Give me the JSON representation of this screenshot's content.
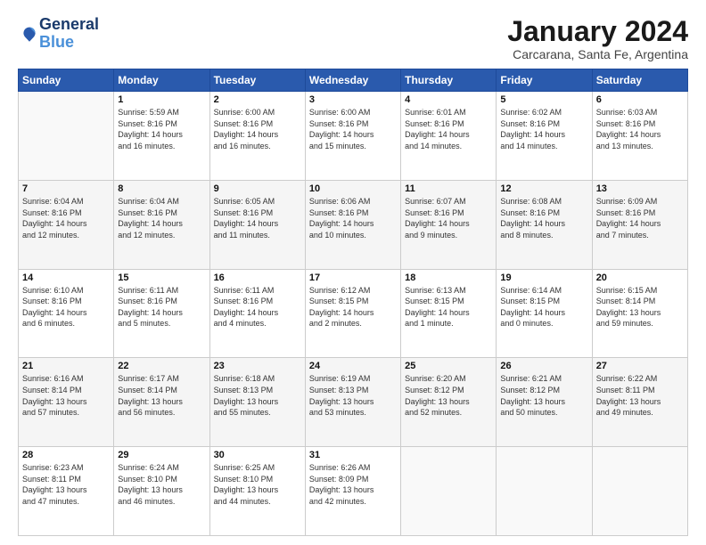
{
  "logo": {
    "line1": "General",
    "line2": "Blue"
  },
  "title": "January 2024",
  "subtitle": "Carcarana, Santa Fe, Argentina",
  "weekdays": [
    "Sunday",
    "Monday",
    "Tuesday",
    "Wednesday",
    "Thursday",
    "Friday",
    "Saturday"
  ],
  "weeks": [
    [
      {
        "day": "",
        "info": ""
      },
      {
        "day": "1",
        "info": "Sunrise: 5:59 AM\nSunset: 8:16 PM\nDaylight: 14 hours\nand 16 minutes."
      },
      {
        "day": "2",
        "info": "Sunrise: 6:00 AM\nSunset: 8:16 PM\nDaylight: 14 hours\nand 16 minutes."
      },
      {
        "day": "3",
        "info": "Sunrise: 6:00 AM\nSunset: 8:16 PM\nDaylight: 14 hours\nand 15 minutes."
      },
      {
        "day": "4",
        "info": "Sunrise: 6:01 AM\nSunset: 8:16 PM\nDaylight: 14 hours\nand 14 minutes."
      },
      {
        "day": "5",
        "info": "Sunrise: 6:02 AM\nSunset: 8:16 PM\nDaylight: 14 hours\nand 14 minutes."
      },
      {
        "day": "6",
        "info": "Sunrise: 6:03 AM\nSunset: 8:16 PM\nDaylight: 14 hours\nand 13 minutes."
      }
    ],
    [
      {
        "day": "7",
        "info": "Sunrise: 6:04 AM\nSunset: 8:16 PM\nDaylight: 14 hours\nand 12 minutes."
      },
      {
        "day": "8",
        "info": "Sunrise: 6:04 AM\nSunset: 8:16 PM\nDaylight: 14 hours\nand 12 minutes."
      },
      {
        "day": "9",
        "info": "Sunrise: 6:05 AM\nSunset: 8:16 PM\nDaylight: 14 hours\nand 11 minutes."
      },
      {
        "day": "10",
        "info": "Sunrise: 6:06 AM\nSunset: 8:16 PM\nDaylight: 14 hours\nand 10 minutes."
      },
      {
        "day": "11",
        "info": "Sunrise: 6:07 AM\nSunset: 8:16 PM\nDaylight: 14 hours\nand 9 minutes."
      },
      {
        "day": "12",
        "info": "Sunrise: 6:08 AM\nSunset: 8:16 PM\nDaylight: 14 hours\nand 8 minutes."
      },
      {
        "day": "13",
        "info": "Sunrise: 6:09 AM\nSunset: 8:16 PM\nDaylight: 14 hours\nand 7 minutes."
      }
    ],
    [
      {
        "day": "14",
        "info": "Sunrise: 6:10 AM\nSunset: 8:16 PM\nDaylight: 14 hours\nand 6 minutes."
      },
      {
        "day": "15",
        "info": "Sunrise: 6:11 AM\nSunset: 8:16 PM\nDaylight: 14 hours\nand 5 minutes."
      },
      {
        "day": "16",
        "info": "Sunrise: 6:11 AM\nSunset: 8:16 PM\nDaylight: 14 hours\nand 4 minutes."
      },
      {
        "day": "17",
        "info": "Sunrise: 6:12 AM\nSunset: 8:15 PM\nDaylight: 14 hours\nand 2 minutes."
      },
      {
        "day": "18",
        "info": "Sunrise: 6:13 AM\nSunset: 8:15 PM\nDaylight: 14 hours\nand 1 minute."
      },
      {
        "day": "19",
        "info": "Sunrise: 6:14 AM\nSunset: 8:15 PM\nDaylight: 14 hours\nand 0 minutes."
      },
      {
        "day": "20",
        "info": "Sunrise: 6:15 AM\nSunset: 8:14 PM\nDaylight: 13 hours\nand 59 minutes."
      }
    ],
    [
      {
        "day": "21",
        "info": "Sunrise: 6:16 AM\nSunset: 8:14 PM\nDaylight: 13 hours\nand 57 minutes."
      },
      {
        "day": "22",
        "info": "Sunrise: 6:17 AM\nSunset: 8:14 PM\nDaylight: 13 hours\nand 56 minutes."
      },
      {
        "day": "23",
        "info": "Sunrise: 6:18 AM\nSunset: 8:13 PM\nDaylight: 13 hours\nand 55 minutes."
      },
      {
        "day": "24",
        "info": "Sunrise: 6:19 AM\nSunset: 8:13 PM\nDaylight: 13 hours\nand 53 minutes."
      },
      {
        "day": "25",
        "info": "Sunrise: 6:20 AM\nSunset: 8:12 PM\nDaylight: 13 hours\nand 52 minutes."
      },
      {
        "day": "26",
        "info": "Sunrise: 6:21 AM\nSunset: 8:12 PM\nDaylight: 13 hours\nand 50 minutes."
      },
      {
        "day": "27",
        "info": "Sunrise: 6:22 AM\nSunset: 8:11 PM\nDaylight: 13 hours\nand 49 minutes."
      }
    ],
    [
      {
        "day": "28",
        "info": "Sunrise: 6:23 AM\nSunset: 8:11 PM\nDaylight: 13 hours\nand 47 minutes."
      },
      {
        "day": "29",
        "info": "Sunrise: 6:24 AM\nSunset: 8:10 PM\nDaylight: 13 hours\nand 46 minutes."
      },
      {
        "day": "30",
        "info": "Sunrise: 6:25 AM\nSunset: 8:10 PM\nDaylight: 13 hours\nand 44 minutes."
      },
      {
        "day": "31",
        "info": "Sunrise: 6:26 AM\nSunset: 8:09 PM\nDaylight: 13 hours\nand 42 minutes."
      },
      {
        "day": "",
        "info": ""
      },
      {
        "day": "",
        "info": ""
      },
      {
        "day": "",
        "info": ""
      }
    ]
  ]
}
